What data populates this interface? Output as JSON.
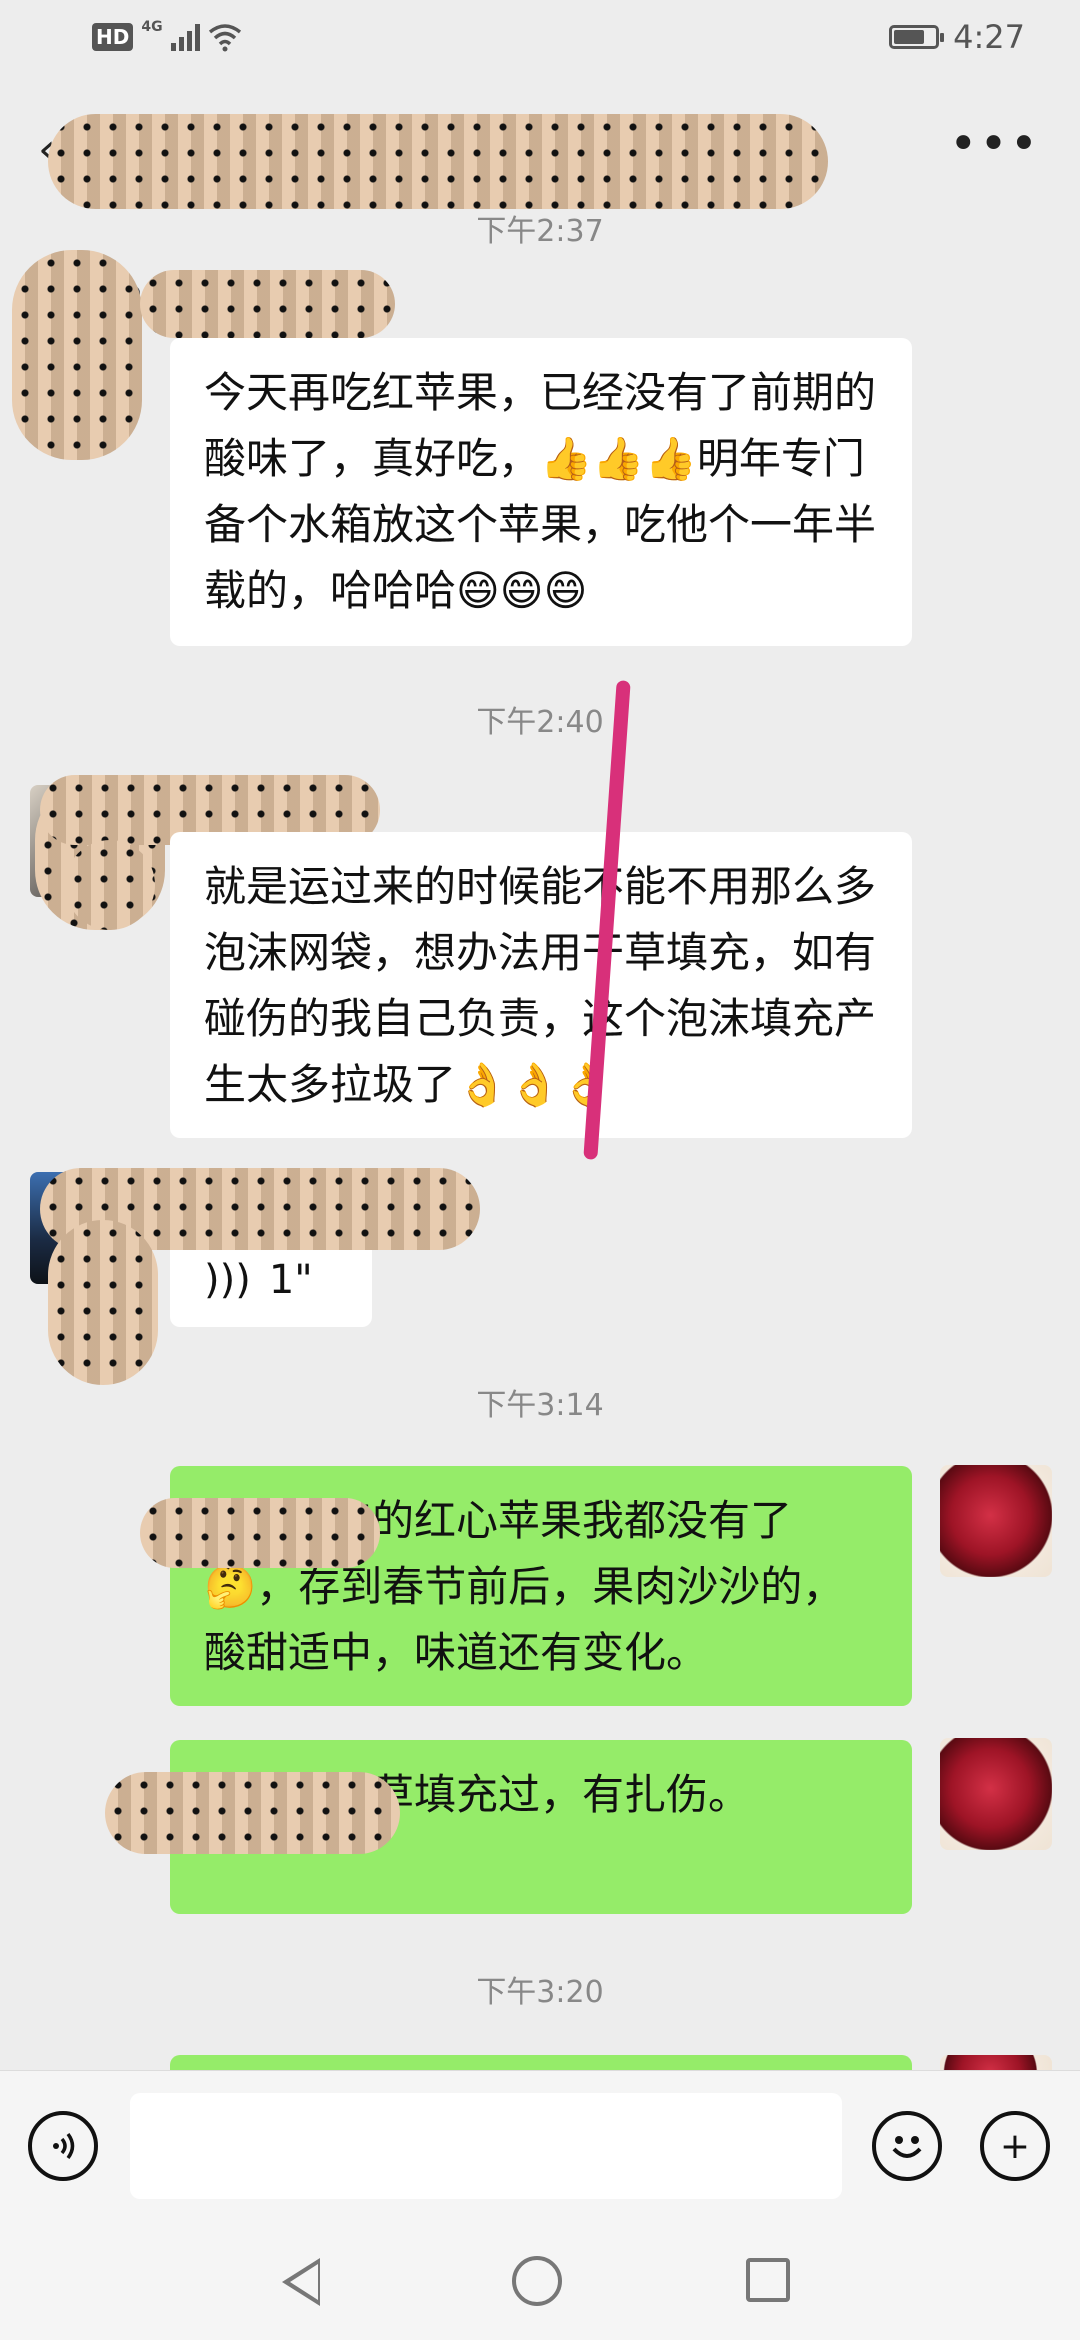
{
  "status_bar": {
    "hd": "HD",
    "network": "4G",
    "time": "4:27"
  },
  "header": {
    "back_icon": "chevron-left-icon",
    "more_icon": "more-dots-icon",
    "more_label": "•••"
  },
  "messages": [
    {
      "type": "timestamp",
      "text": "下午2:37"
    },
    {
      "type": "incoming",
      "text": "今天再吃红苹果，已经没有了前期的酸味了，真好吃，👍👍👍明年专门备个水箱放这个苹果，吃他个一年半载的，哈哈哈😄😄😄"
    },
    {
      "type": "timestamp",
      "text": "下午2:40"
    },
    {
      "type": "incoming",
      "text": "就是运过来的时候能不能不用那么多泡沫网袋，想办法用干草填充，如有碰伤的我自己负责，这个泡沫填充产生太多拉圾了👌👌👌"
    },
    {
      "type": "incoming_voice",
      "duration": "1\""
    },
    {
      "type": "timestamp",
      "text": "下午3:14"
    },
    {
      "type": "outgoing",
      "text": "@…今年的红心苹果我都没有了🤔，存到春节前后，果肉沙沙的，酸甜适中，味道还有变化。"
    },
    {
      "type": "outgoing",
      "text": "…年用干草填充过，有扎伤。"
    },
    {
      "type": "timestamp",
      "text": "下午3:20"
    }
  ],
  "input_bar": {
    "voice_icon": "voice-icon",
    "emoji_icon": "emoji-icon",
    "plus_icon": "plus-icon",
    "plus_label": "+"
  },
  "nav_bar": {
    "back": "nav-back-icon",
    "home": "nav-home-icon",
    "recent": "nav-recent-icon"
  },
  "colors": {
    "background": "#ededed",
    "incoming_bubble": "#ffffff",
    "outgoing_bubble": "#95ec69",
    "timestamp": "#888888"
  }
}
